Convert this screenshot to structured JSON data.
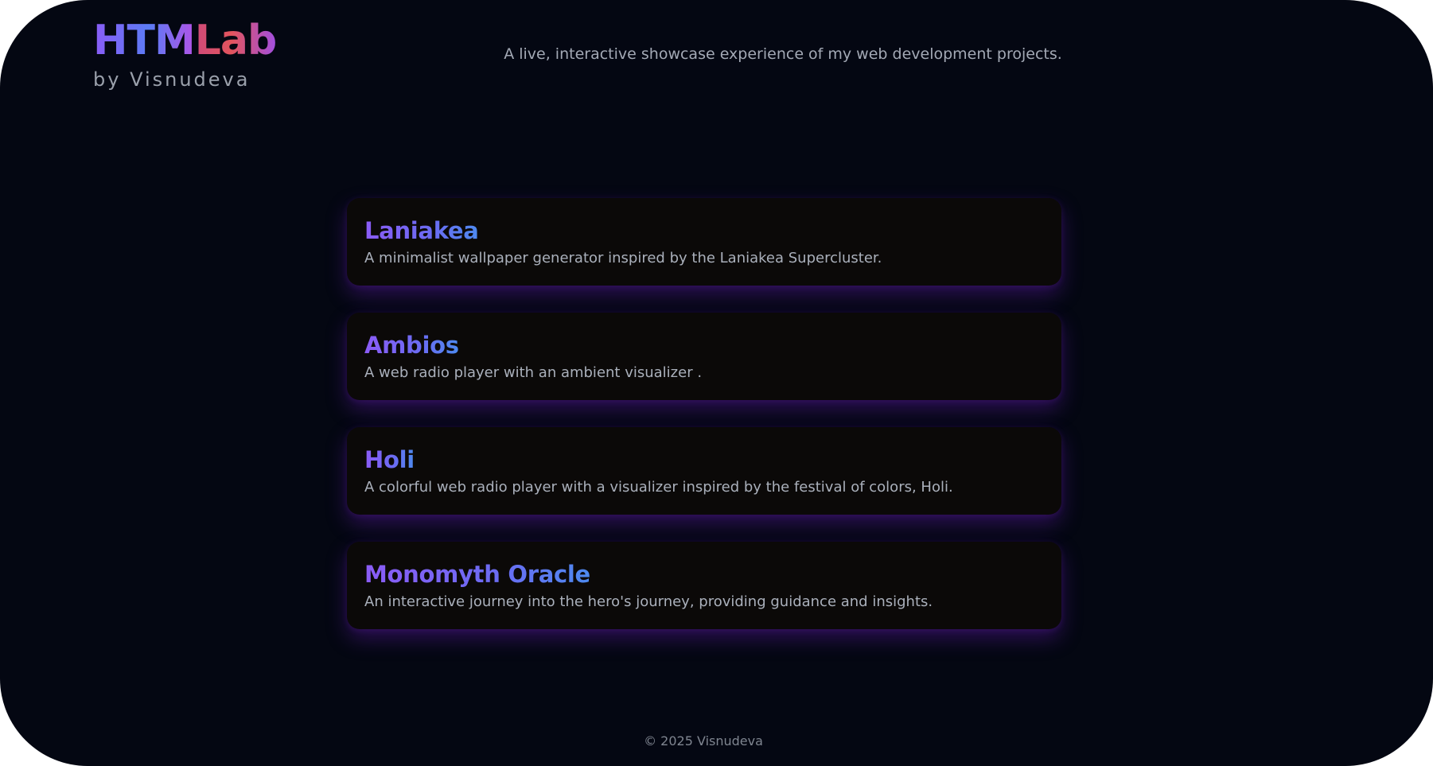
{
  "brand": {
    "title_part_a": "HTM",
    "title_part_b": "Lab",
    "subtitle": "by Visnudeva"
  },
  "header": {
    "tagline": "A live, interactive showcase experience of my web development projects."
  },
  "projects": [
    {
      "title": "Laniakea",
      "description": "A minimalist wallpaper generator inspired by the Laniakea Supercluster."
    },
    {
      "title": "Ambios",
      "description": "A web radio player with an ambient visualizer ."
    },
    {
      "title": "Holi",
      "description": "A colorful web radio player with a visualizer inspired by the festival of colors, Holi."
    },
    {
      "title": "Monomyth Oracle",
      "description": "An interactive journey into the hero's journey, providing guidance and insights."
    }
  ],
  "footer": {
    "copyright": "© 2025 Visnudeva"
  },
  "colors": {
    "background": "#040712",
    "card_background": "#0b0908",
    "card_glow": "#5f1caa",
    "accent_purple": "#8b5cf6",
    "accent_blue": "#4d8af0",
    "accent_red": "#e2545d",
    "text_muted": "#aab0bb"
  }
}
